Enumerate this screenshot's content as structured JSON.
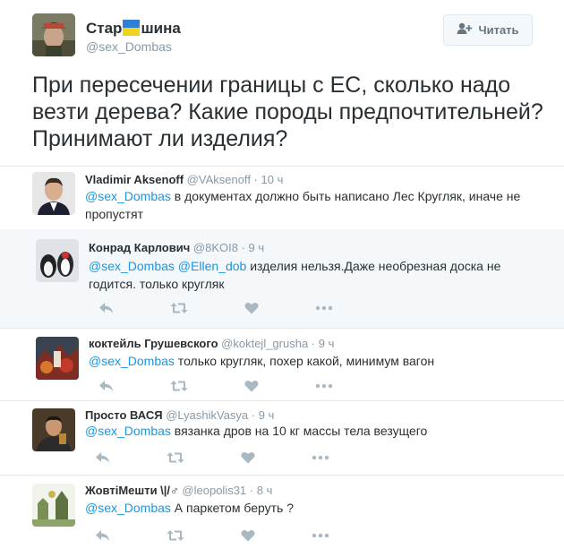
{
  "main": {
    "name_before": "Стар",
    "name_after": "шина",
    "handle": "@sex_Dombas",
    "follow_label": "Читать",
    "text": "При пересечении границы с ЕС, сколько надо везти дерева? Какие породы предпочтительней? Принимают ли изделия?"
  },
  "replies": [
    {
      "name": "Vladimir Aksenoff",
      "handle": "@VAksenoff",
      "time": "10 ч",
      "mention": "@sex_Dombas",
      "mention2": "",
      "text": " в документах должно быть написано Лес Кругляк, иначе не пропустят"
    },
    {
      "name": "Конрад Карлович",
      "handle": "@8KOI8",
      "time": "9 ч",
      "mention": "@sex_Dombas",
      "mention2": " @Ellen_dob",
      "text": " изделия нельзя.Даже необрезная доска не годится. только кругляк"
    },
    {
      "name": "коктейль Грушевского",
      "handle": "@koktejl_grusha",
      "time": "9 ч",
      "mention": "@sex_Dombas",
      "mention2": "",
      "text": " только кругляк, похер какой, минимум вагон"
    },
    {
      "name": "Просто ВАСЯ",
      "handle": "@LyashikVasya",
      "time": "9 ч",
      "mention": "@sex_Dombas",
      "mention2": "",
      "text": " вязанка дров на 10 кг массы тела везущего"
    },
    {
      "name": "ЖовтіМешти \\|/♂",
      "handle": "@leopolis31",
      "time": "8 ч",
      "mention": "@sex_Dombas",
      "mention2": "",
      "text": " А паркетом беруть ?"
    }
  ],
  "sep": " · ",
  "icons": [
    "reply-icon",
    "retweet-icon",
    "like-icon",
    "more-icon",
    "follow-person-icon"
  ],
  "colors": {
    "mention": "#1b95e0",
    "muted": "#8899a6",
    "icon": "#aab8c2",
    "flag_blue": "#2f7fd6",
    "flag_yellow": "#f2d31b"
  }
}
